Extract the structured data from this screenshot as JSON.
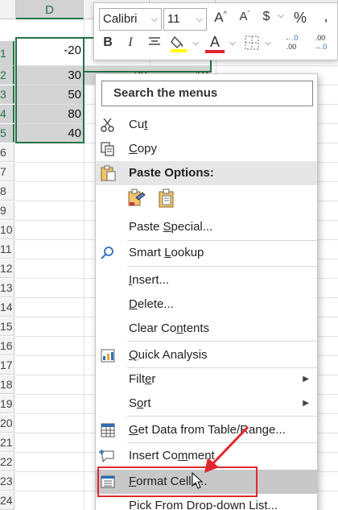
{
  "spreadsheet": {
    "column_header": "D",
    "row_numbers": [
      "1",
      "2",
      "3",
      "4",
      "5",
      "6",
      "7",
      "8",
      "9",
      "10",
      "11",
      "12",
      "13",
      "14",
      "15",
      "16",
      "17",
      "18",
      "19",
      "20",
      "21",
      "22",
      "23",
      "24",
      "25"
    ],
    "cells_col_d": [
      "-20",
      "30",
      "50",
      "80",
      "40"
    ],
    "cells_col_e_visible": [
      "20",
      "10"
    ]
  },
  "mini_toolbar": {
    "font_name": "Calibri",
    "font_size": "11",
    "increase_font": "A",
    "decrease_font": "A",
    "currency": "$",
    "percent": "%",
    "bold": "B",
    "italic": "I",
    "font_color_letter": "A",
    "increase_decimal_top": "←.0",
    "increase_decimal_bottom": ".00",
    "decrease_decimal_top": ".00",
    "decrease_decimal_bottom": "→.0",
    "colors": {
      "highlight": "#ffff00",
      "font_color": "#e0262f"
    }
  },
  "context_menu": {
    "search_label": "Search the menus",
    "paste_options_label": "Paste Options:",
    "items": [
      {
        "pre": "Cu",
        "u": "t",
        "post": ""
      },
      {
        "pre": "",
        "u": "C",
        "post": "opy"
      },
      {
        "pre": "Paste ",
        "u": "S",
        "post": "pecial..."
      },
      {
        "pre": "Smart ",
        "u": "L",
        "post": "ookup"
      },
      {
        "pre": "",
        "u": "I",
        "post": "nsert..."
      },
      {
        "pre": "",
        "u": "D",
        "post": "elete..."
      },
      {
        "pre": "Clear Co",
        "u": "n",
        "post": "tents"
      },
      {
        "pre": "",
        "u": "Q",
        "post": "uick Analysis"
      },
      {
        "pre": "Filt",
        "u": "e",
        "post": "r"
      },
      {
        "pre": "S",
        "u": "o",
        "post": "rt"
      },
      {
        "pre": "",
        "u": "G",
        "post": "et Data from Table/Range..."
      },
      {
        "pre": "Insert Co",
        "u": "m",
        "post": "ment"
      },
      {
        "pre": "",
        "u": "F",
        "post": "ormat Cells..."
      },
      {
        "pre": "Pic",
        "u": "k",
        "post": " From Drop-down List..."
      }
    ]
  },
  "annotation": {
    "color": "#e0262f"
  }
}
